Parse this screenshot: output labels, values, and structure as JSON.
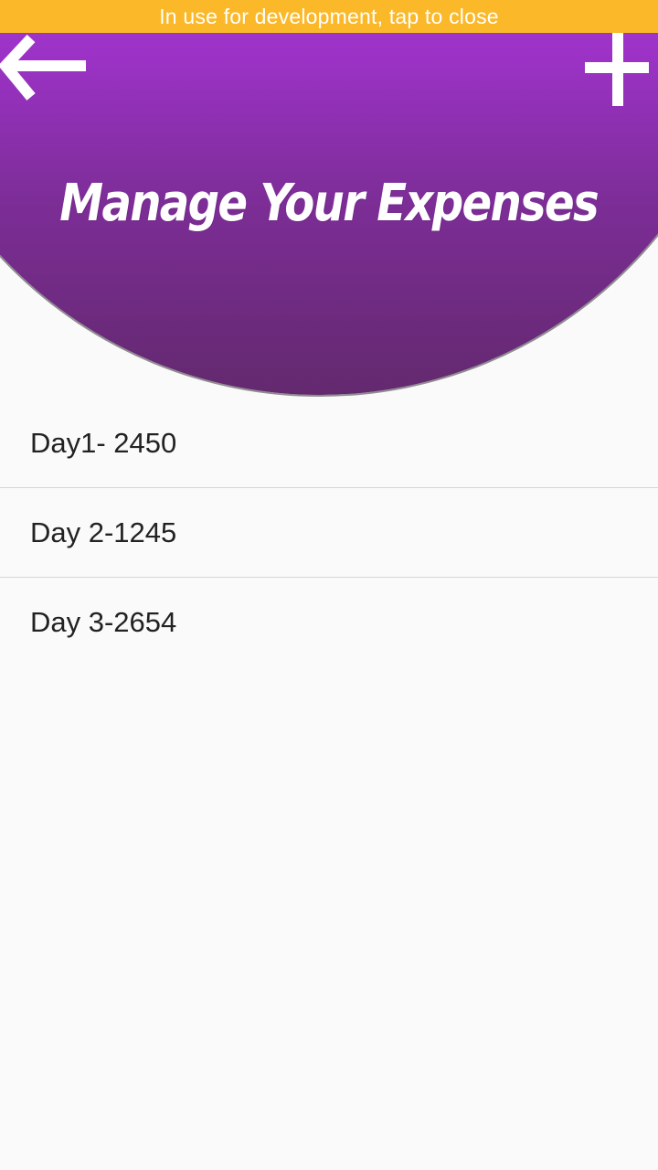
{
  "dev_banner": {
    "text": "In use for development, tap to close",
    "color": "#fbb829"
  },
  "header": {
    "title": "Manage Your Expenses",
    "back_icon": "arrow-left-icon",
    "add_icon": "plus-icon",
    "gradient_top": "#b43ae0",
    "gradient_bottom": "#63296e"
  },
  "expenses": [
    {
      "label": "Day1- 2450"
    },
    {
      "label": "Day 2-1245"
    },
    {
      "label": "Day 3-2654"
    }
  ]
}
